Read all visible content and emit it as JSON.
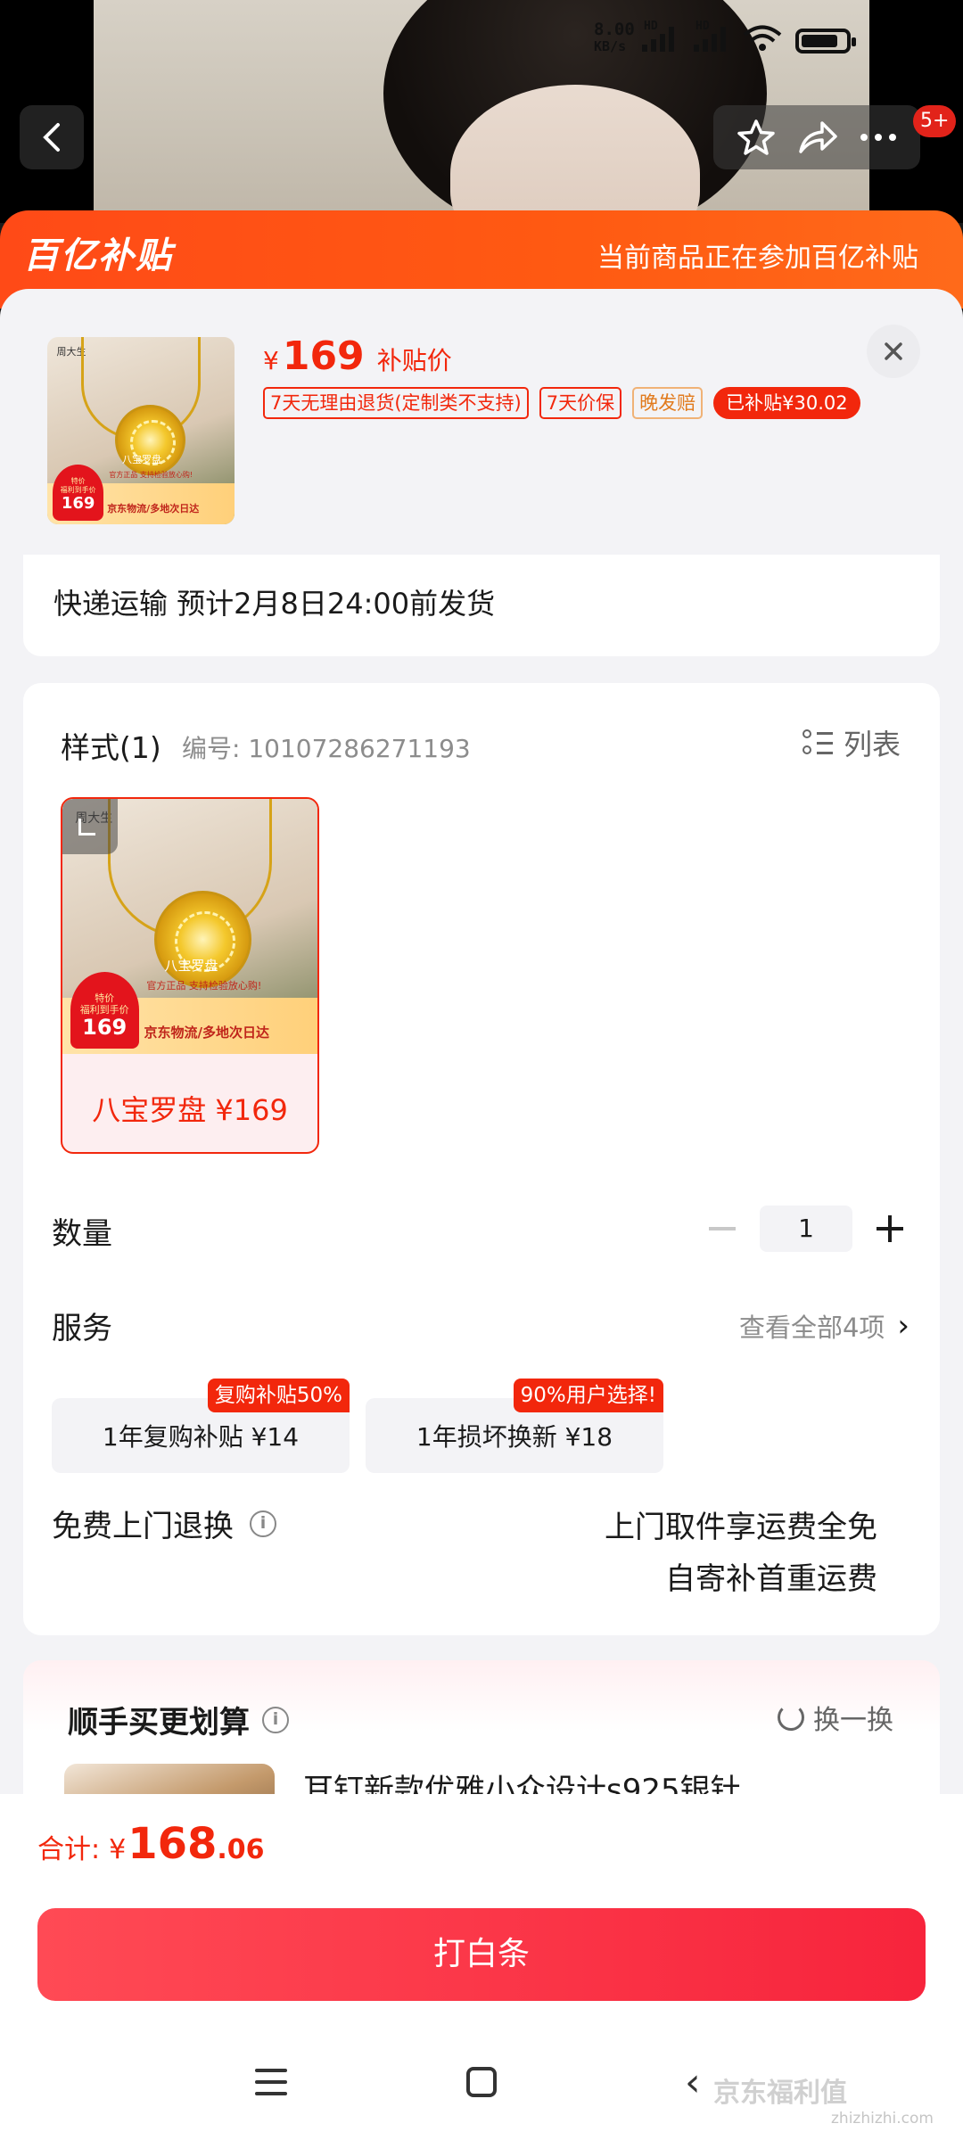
{
  "status_bar": {
    "net_speed": "8.00",
    "net_unit": "KB/s",
    "hd1": "HD",
    "hd2": "HD",
    "notif_count": "5+"
  },
  "sheet": {
    "brand_logo_text": "百亿补贴",
    "banner_text": "当前商品正在参加百亿补贴",
    "product": {
      "currency": "¥",
      "price": "169",
      "price_label": "补贴价",
      "tags": [
        "7天无理由退货(定制类不支持)",
        "7天价保",
        "晚发赔",
        "已补贴¥30.02"
      ]
    },
    "shipping": "快递运输 预计2月8日24:00前发货",
    "style": {
      "title": "样式(1)",
      "code": "编号: 10107286271193",
      "list_label": "列表",
      "sku_label": "八宝罗盘 ¥169"
    },
    "quantity": {
      "label": "数量",
      "value": "1"
    },
    "service": {
      "label": "服务",
      "see_all": "查看全部4项",
      "items": [
        {
          "name": "1年复购补贴  ¥14",
          "badge": "复购补贴50%"
        },
        {
          "name": "1年损坏换新  ¥18",
          "badge": "90%用户选择!"
        }
      ]
    },
    "return": {
      "label": "免费上门退换",
      "line1": "上门取件享运费全免",
      "line2": "自寄补首重运费"
    },
    "recommend": {
      "title": "顺手买更划算",
      "swap": "换一换",
      "item_name": "耳钉新款优雅小众设计s925银针"
    }
  },
  "bottom": {
    "total_label": "合计:",
    "currency": "¥",
    "total_int": "168",
    "total_dec": ".06",
    "pay_button": "打白条"
  },
  "watermark": {
    "text": "京东福利值",
    "site": "zhizhizhi.com"
  },
  "colors": {
    "accent": "#f2270c",
    "banner": "#ff4a17",
    "pay": "#f7243c"
  }
}
